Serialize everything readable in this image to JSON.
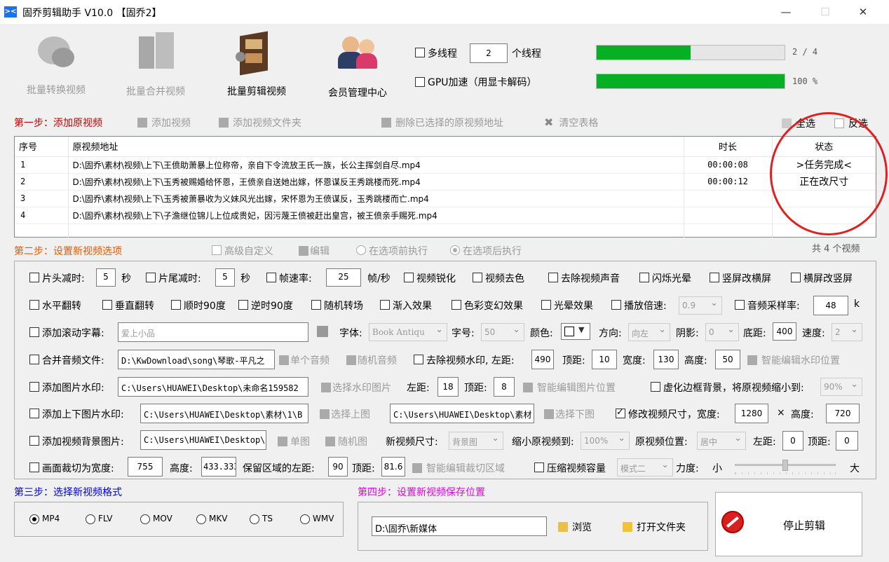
{
  "window": {
    "title": "固乔剪辑助手 V10.0 【固乔2】",
    "controls": {
      "minimize": "—",
      "maximize": "☐",
      "close": "✕"
    }
  },
  "toolbar": {
    "buttons": [
      {
        "label": "批量转换视频",
        "icon": "chat-bubble-icon",
        "enabled": false
      },
      {
        "label": "批量合并视频",
        "icon": "buildings-icon",
        "enabled": false
      },
      {
        "label": "批量剪辑视频",
        "icon": "film-reel-icon",
        "enabled": true
      },
      {
        "label": "会员管理中心",
        "icon": "users-icon",
        "enabled": true
      }
    ],
    "multithread_label": "多线程",
    "thread_count": "2",
    "thread_suffix": "个线程",
    "gpu_label": "GPU加速（用显卡解码）",
    "progress1_text": "2 / 4",
    "progress1_value": 0.5,
    "progress2_text": "100 %",
    "progress2_value": 1.0
  },
  "step1": {
    "title": "第一步：添加原视频",
    "add_video": "添加视频",
    "add_folder": "添加视频文件夹",
    "delete_selected": "删除已选择的原视频地址",
    "clear_table": "清空表格",
    "select_all": "全选",
    "invert_select": "反选",
    "columns": [
      "序号",
      "原视频地址",
      "时长",
      "状态"
    ],
    "rows": [
      {
        "no": "1",
        "path": "D:\\固乔\\素材\\视频\\上下\\王偾助萧暴上位称帝，亲自下令流放王氏一族，长公主挥剑自尽.mp4",
        "duration": "00:00:08",
        "status": ">任务完成<"
      },
      {
        "no": "2",
        "path": "D:\\固乔\\素材\\视频\\上下\\玉秀被赐婚给怀恩，王偾亲自送她出嫁，怀恩谋反王秀跳楼而死.mp4",
        "duration": "00:00:12",
        "status": "正在改尺寸"
      },
      {
        "no": "3",
        "path": "D:\\固乔\\素材\\视频\\上下\\玉秀被萧暴收为义妹风光出嫁，宋怀恩为王偾谋反，玉秀跳楼而亡.mp4",
        "duration": "",
        "status": ""
      },
      {
        "no": "4",
        "path": "D:\\固乔\\素材\\视频\\上下\\子澹继位锦儿上位成贵妃，因污蔑王偾被赶出皇宫，被王偾亲手赐死.mp4",
        "duration": "",
        "status": ""
      }
    ]
  },
  "step2": {
    "title": "第二步：设置新视频选项",
    "advanced": "高级自定义",
    "edit": "编辑",
    "before": "在选项前执行",
    "after": "在选项后执行",
    "count": "共 4 个视频",
    "head_cut": "片头减时:",
    "head_val": "5",
    "sec1": "秒",
    "tail_cut": "片尾减时:",
    "tail_val": "5",
    "sec2": "秒",
    "fps": "帧速率:",
    "fps_val": "25",
    "fps_unit": "帧/秒",
    "sharpen": "视频锐化",
    "decolor": "视频去色",
    "remove_audio": "去除视频声音",
    "flash": "闪烁光晕",
    "v2h": "竖屏改横屏",
    "h2v": "横屏改竖屏",
    "hflip": "水平翻转",
    "vflip": "垂直翻转",
    "cw90": "顺时90度",
    "ccw90": "逆时90度",
    "rand_trans": "随机转场",
    "fade": "渐入效果",
    "color_fx": "色彩变幻效果",
    "light_fx": "光晕效果",
    "speed": "播放倍速:",
    "speed_val": "0.9",
    "sample": "音频采样率:",
    "sample_val": "48",
    "sample_unit": "k",
    "scroll": "添加滚动字幕:",
    "scroll_text": "爱上小品",
    "font": "字体:",
    "font_val": "Book Antiqu",
    "fsize": "字号:",
    "fsize_val": "50",
    "color": "颜色:",
    "dir": "方向:",
    "dir_val": "向左",
    "shadow": "阴影:",
    "shadow_val": "0",
    "bottom": "底距:",
    "bottom_val": "400",
    "spd": "速度:",
    "spd_val": "2",
    "merge_audio": "合并音频文件:",
    "audio_path": "D:\\KwDownload\\song\\琴歌-平凡之",
    "single_audio": "单个音频",
    "rand_audio": "随机音频",
    "remove_wm": "去除视频水印, 左距:",
    "wm_left": "490",
    "top_lbl": "顶距:",
    "wm_top": "10",
    "width_lbl": "宽度:",
    "wm_w": "130",
    "height_lbl": "高度:",
    "wm_h": "50",
    "smart_wm": "智能编辑水印位置",
    "img_wm": "添加图片水印:",
    "img_path": "C:\\Users\\HUAWEI\\Desktop\\未命名159582",
    "select_img": "选择水印图片",
    "left_lbl": "左距:",
    "img_left": "18",
    "img_top": "8",
    "smart_img": "智能编辑图片位置",
    "blur_bg": "虚化边框背景，将原视频缩小到:",
    "blur_val": "90%",
    "tb_wm": "添加上下图片水印:",
    "top_img_path": "C:\\Users\\HUAWEI\\Desktop\\素材\\1\\B",
    "select_top": "选择上图",
    "bot_img_path": "C:\\Users\\HUAWEI\\Desktop\\素材",
    "select_bot": "选择下图",
    "resize": "修改视频尺寸，宽度:",
    "resize_w": "1280",
    "times": "×",
    "height2": "高度:",
    "resize_h": "720",
    "bg_img": "添加视频背景图片:",
    "bg_path": "C:\\Users\\HUAWEI\\Desktop\\",
    "single_img": "单图",
    "rand_img": "随机图",
    "new_size": "新视频尺寸:",
    "new_size_val": "背景图",
    "shrink": "缩小原视频到:",
    "shrink_val": "100%",
    "orig_pos": "原视频位置:",
    "orig_pos_val": "居中",
    "pos_left": "0",
    "pos_top": "0",
    "crop": "画面裁切为宽度:",
    "crop_w": "755",
    "crop_h_lbl": "高度:",
    "crop_h": "433.333",
    "keep_left": "保留区域的左距:",
    "keep_left_val": "90",
    "keep_top_lbl": "顶距:",
    "keep_top": "81.6",
    "smart_crop": "智能编辑裁切区域",
    "compress": "压缩视频容量",
    "compress_mode": "模式二",
    "strength": "力度:",
    "small": "小",
    "big": "大",
    "strength_value": 0.5
  },
  "step3": {
    "title": "第三步：选择新视频格式",
    "formats": [
      "MP4",
      "FLV",
      "MOV",
      "MKV",
      "TS",
      "WMV"
    ],
    "selected": "MP4"
  },
  "step4": {
    "title": "第四步：设置新视频保存位置",
    "path": "D:\\固乔\\新媒体",
    "browse": "浏览",
    "open_folder": "打开文件夹"
  },
  "stop_button": "停止剪辑",
  "colors": {
    "accent_red": "#e02020",
    "progress_green": "#06b025",
    "step_blue": "#0000d0",
    "step_orange": "#e35a00",
    "step_magenta": "#e000e0"
  }
}
